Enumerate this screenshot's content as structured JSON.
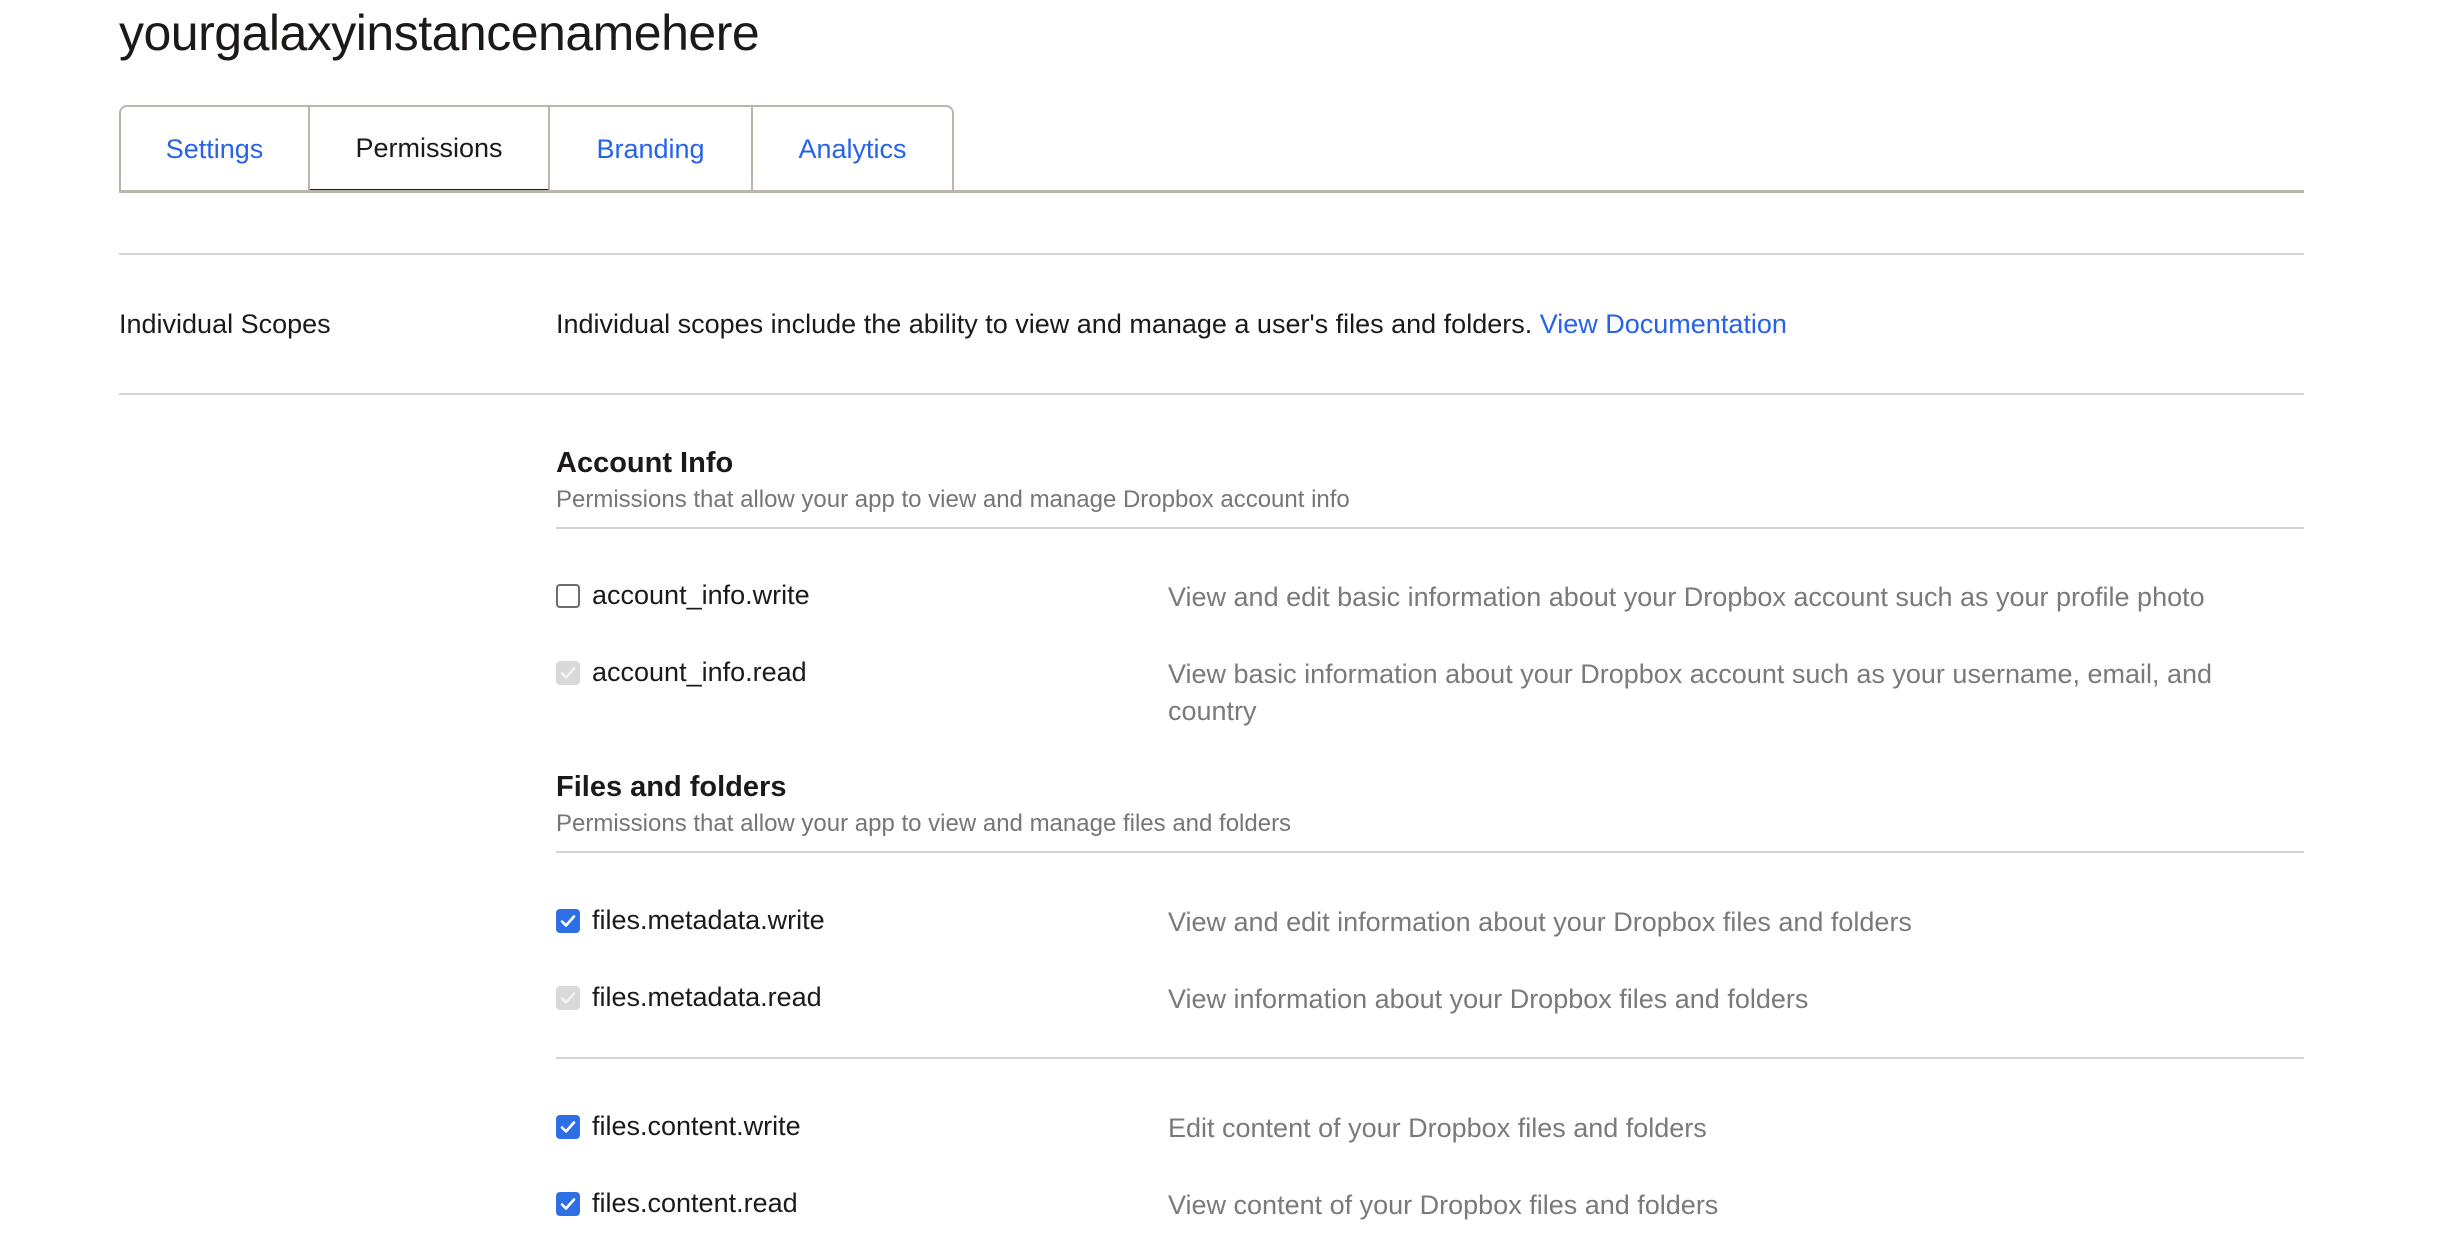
{
  "page": {
    "title": "yourgalaxyinstancenamehere"
  },
  "tabs": [
    {
      "label": "Settings",
      "active": false
    },
    {
      "label": "Permissions",
      "active": true
    },
    {
      "label": "Branding",
      "active": false
    },
    {
      "label": "Analytics",
      "active": false
    }
  ],
  "scopes_intro": {
    "label": "Individual Scopes",
    "description": "Individual scopes include the ability to view and manage a user's files and folders.",
    "link_label": "View Documentation"
  },
  "colors": {
    "accent": "#2563eb",
    "checkbox_checked": "#2f6fe4",
    "checkbox_disabled": "#d9d9d9"
  },
  "sections": [
    {
      "heading": "Account Info",
      "subtitle": "Permissions that allow your app to view and manage Dropbox account info",
      "scopes": [
        {
          "name": "account_info.write",
          "state": "unchecked",
          "description": "View and edit basic information about your Dropbox account such as your profile photo"
        },
        {
          "name": "account_info.read",
          "state": "checked-disabled",
          "description": "View basic information about your Dropbox account such as your username, email, and country"
        }
      ]
    },
    {
      "heading": "Files and folders",
      "subtitle": "Permissions that allow your app to view and manage files and folders",
      "scopes": [
        {
          "name": "files.metadata.write",
          "state": "checked",
          "description": "View and edit information about your Dropbox files and folders"
        },
        {
          "name": "files.metadata.read",
          "state": "checked-disabled",
          "description": "View information about your Dropbox files and folders"
        },
        {
          "name": "files.content.write",
          "state": "checked",
          "description": "Edit content of your Dropbox files and folders"
        },
        {
          "name": "files.content.read",
          "state": "checked",
          "description": "View content of your Dropbox files and folders"
        }
      ]
    }
  ]
}
